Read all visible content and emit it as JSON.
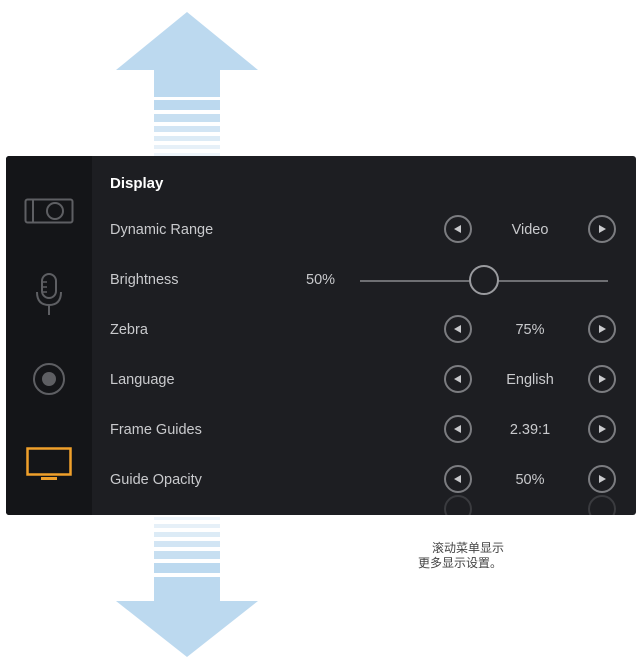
{
  "menu": {
    "title": "Display",
    "rows": [
      {
        "label": "Dynamic Range",
        "value": "Video"
      },
      {
        "label": "Brightness",
        "value": "50%",
        "slider_fraction": 0.5
      },
      {
        "label": "Zebra",
        "value": "75%"
      },
      {
        "label": "Language",
        "value": "English"
      },
      {
        "label": "Frame Guides",
        "value": "2.39:1"
      },
      {
        "label": "Guide Opacity",
        "value": "50%"
      }
    ]
  },
  "sidebar": {
    "items": [
      {
        "icon": "camera-icon",
        "active": false
      },
      {
        "icon": "microphone-icon",
        "active": false
      },
      {
        "icon": "record-icon",
        "active": false
      },
      {
        "icon": "monitor-icon",
        "active": true
      }
    ]
  },
  "caption": {
    "line1": "滚动菜单显示",
    "line2": "更多显示设置。"
  },
  "colors": {
    "panel_bg": "#1d1e22",
    "sidebar_bg": "#141518",
    "active_accent": "#f0a02a",
    "arrow_fill": "#bcd9ef"
  }
}
